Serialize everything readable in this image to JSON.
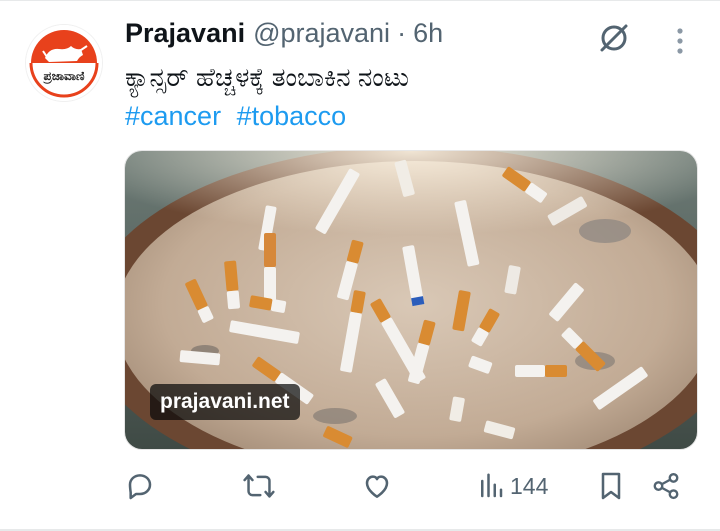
{
  "tweet": {
    "display_name": "Prajavani",
    "handle": "@prajavani",
    "separator": "·",
    "time": "6h",
    "text": "ಕ್ಯಾನ್ಸರ್ ಹೆಚ್ಚಳಕ್ಕೆ ತಂಬಾಕಿನ ನಂಟು",
    "hashtags": [
      "#cancer",
      "#tobacco"
    ],
    "avatar_label": "ಪ್ರಜಾವಾಣಿ"
  },
  "media": {
    "alt": "Cigarette butts stubbed out in a sand-filled ashtray",
    "source_label": "prajavani.net"
  },
  "actions": {
    "reply_icon": "reply-icon",
    "retweet_icon": "retweet-icon",
    "like_icon": "heart-icon",
    "views_icon": "views-icon",
    "views_count": "144",
    "bookmark_icon": "bookmark-icon",
    "share_icon": "share-icon"
  },
  "colors": {
    "accent": "#1d9bf0",
    "text": "#0f1419",
    "secondary": "#536471",
    "avatar_bg": "#e8411c"
  }
}
